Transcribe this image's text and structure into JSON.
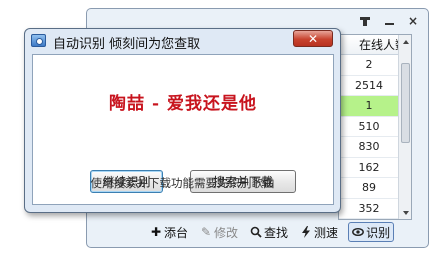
{
  "window": {
    "pin_icon": "pin-icon",
    "minimize_icon": "minimize-icon",
    "close_icon": "close-icon",
    "close_glyph": "×"
  },
  "count_list": {
    "header": "在线人数",
    "items": [
      "2",
      "2514",
      "1",
      "510",
      "830",
      "162",
      "89",
      "352"
    ],
    "selected_index": 2,
    "selected_color": "#b6f28a"
  },
  "toolbar": {
    "items": [
      {
        "label": "添台",
        "icon": "plus-icon",
        "glyph": "✚",
        "state": "enabled"
      },
      {
        "label": "修改",
        "icon": "pencil-icon",
        "glyph": "✎",
        "state": "disabled"
      },
      {
        "label": "查找",
        "icon": "magnifier-icon",
        "glyph": "🔍",
        "state": "enabled"
      },
      {
        "label": "测速",
        "icon": "lightning-icon",
        "glyph": "",
        "state": "enabled"
      },
      {
        "label": "识别",
        "icon": "eye-icon",
        "glyph": "",
        "state": "active"
      }
    ]
  },
  "dialog": {
    "title": "自动识别 倾刻间为您查取",
    "close_glyph": "✕",
    "captcha_text": "陶喆 - 爱我还是他",
    "captcha_color": "#c8141e",
    "continue_button": "继续识别",
    "search_download_button": "搜索并下载",
    "hint": "使用搜索并下载功能需要先识别歌曲"
  }
}
